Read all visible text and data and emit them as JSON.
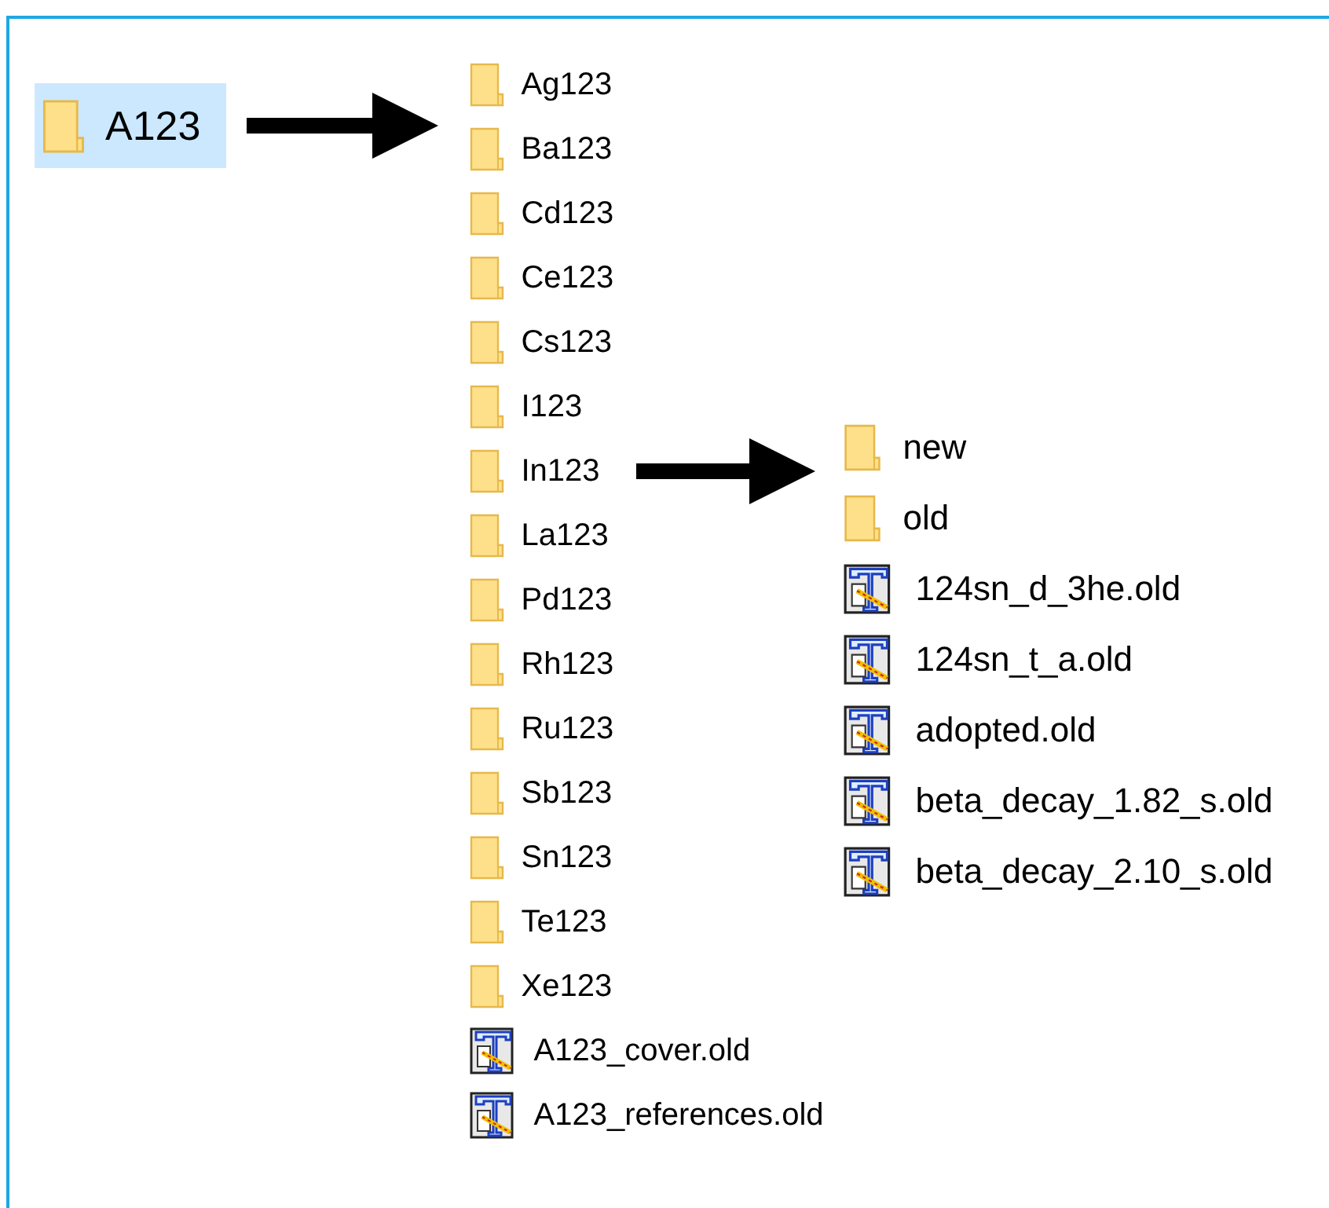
{
  "root": {
    "name": "A123",
    "kind": "folder",
    "selected": true,
    "children": [
      {
        "name": "Ag123",
        "kind": "folder",
        "selected": false
      },
      {
        "name": "Ba123",
        "kind": "folder",
        "selected": false
      },
      {
        "name": "Cd123",
        "kind": "folder",
        "selected": false
      },
      {
        "name": "Ce123",
        "kind": "folder",
        "selected": false
      },
      {
        "name": "Cs123",
        "kind": "folder",
        "selected": false
      },
      {
        "name": "I123",
        "kind": "folder",
        "selected": false
      },
      {
        "name": "In123",
        "kind": "folder",
        "selected": false,
        "children": [
          {
            "name": "new",
            "kind": "folder",
            "selected": false
          },
          {
            "name": "old",
            "kind": "folder",
            "selected": false
          },
          {
            "name": "124sn_d_3he.old",
            "kind": "file",
            "selected": false
          },
          {
            "name": "124sn_t_a.old",
            "kind": "file",
            "selected": false
          },
          {
            "name": "adopted.old",
            "kind": "file",
            "selected": false
          },
          {
            "name": "beta_decay_1.82_s.old",
            "kind": "file",
            "selected": false
          },
          {
            "name": "beta_decay_2.10_s.old",
            "kind": "file",
            "selected": false
          }
        ]
      },
      {
        "name": "La123",
        "kind": "folder",
        "selected": false
      },
      {
        "name": "Pd123",
        "kind": "folder",
        "selected": false
      },
      {
        "name": "Rh123",
        "kind": "folder",
        "selected": false
      },
      {
        "name": "Ru123",
        "kind": "folder",
        "selected": false
      },
      {
        "name": "Sb123",
        "kind": "folder",
        "selected": false
      },
      {
        "name": "Sn123",
        "kind": "folder",
        "selected": false
      },
      {
        "name": "Te123",
        "kind": "folder",
        "selected": false
      },
      {
        "name": "Xe123",
        "kind": "folder",
        "selected": false
      },
      {
        "name": "A123_cover.old",
        "kind": "file",
        "selected": false
      },
      {
        "name": "A123_references.old",
        "kind": "file",
        "selected": false
      }
    ]
  }
}
